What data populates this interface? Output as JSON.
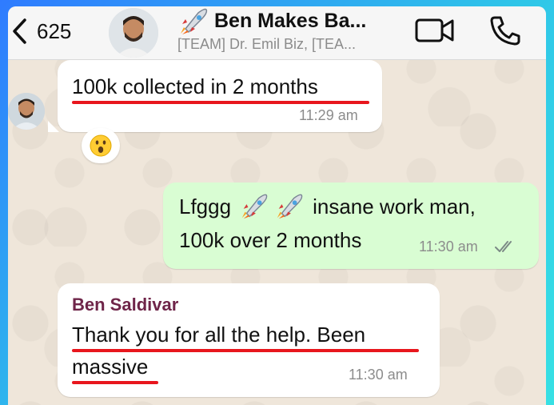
{
  "header": {
    "back_count": "625",
    "title": "Ben Makes Ba...",
    "subtitle": "[TEAM] Dr. Emil Biz, [TEA..."
  },
  "messages": [
    {
      "direction": "incoming",
      "text": "100k collected in 2 months",
      "time": "11:29 am",
      "reaction": "surprised-face-emoji"
    },
    {
      "direction": "outgoing",
      "line1_before": "Lfggg",
      "line1_after": "insane work man,",
      "line2": "100k over 2 months",
      "time": "11:30 am",
      "status": "read-double-check-icon"
    },
    {
      "direction": "incoming",
      "sender": "Ben Saldivar",
      "line1": "Thank you for all the help. Been",
      "line2": "massive",
      "time": "11:30 am"
    }
  ],
  "colors": {
    "chat_background": "#efe6da",
    "incoming_bubble": "#ffffff",
    "outgoing_bubble": "#d9fdd3",
    "highlight_underline": "#e8161d",
    "sender_name": "#6f2549",
    "frame_gradient_start": "#2f7bff",
    "frame_gradient_end": "#37e0e4"
  }
}
